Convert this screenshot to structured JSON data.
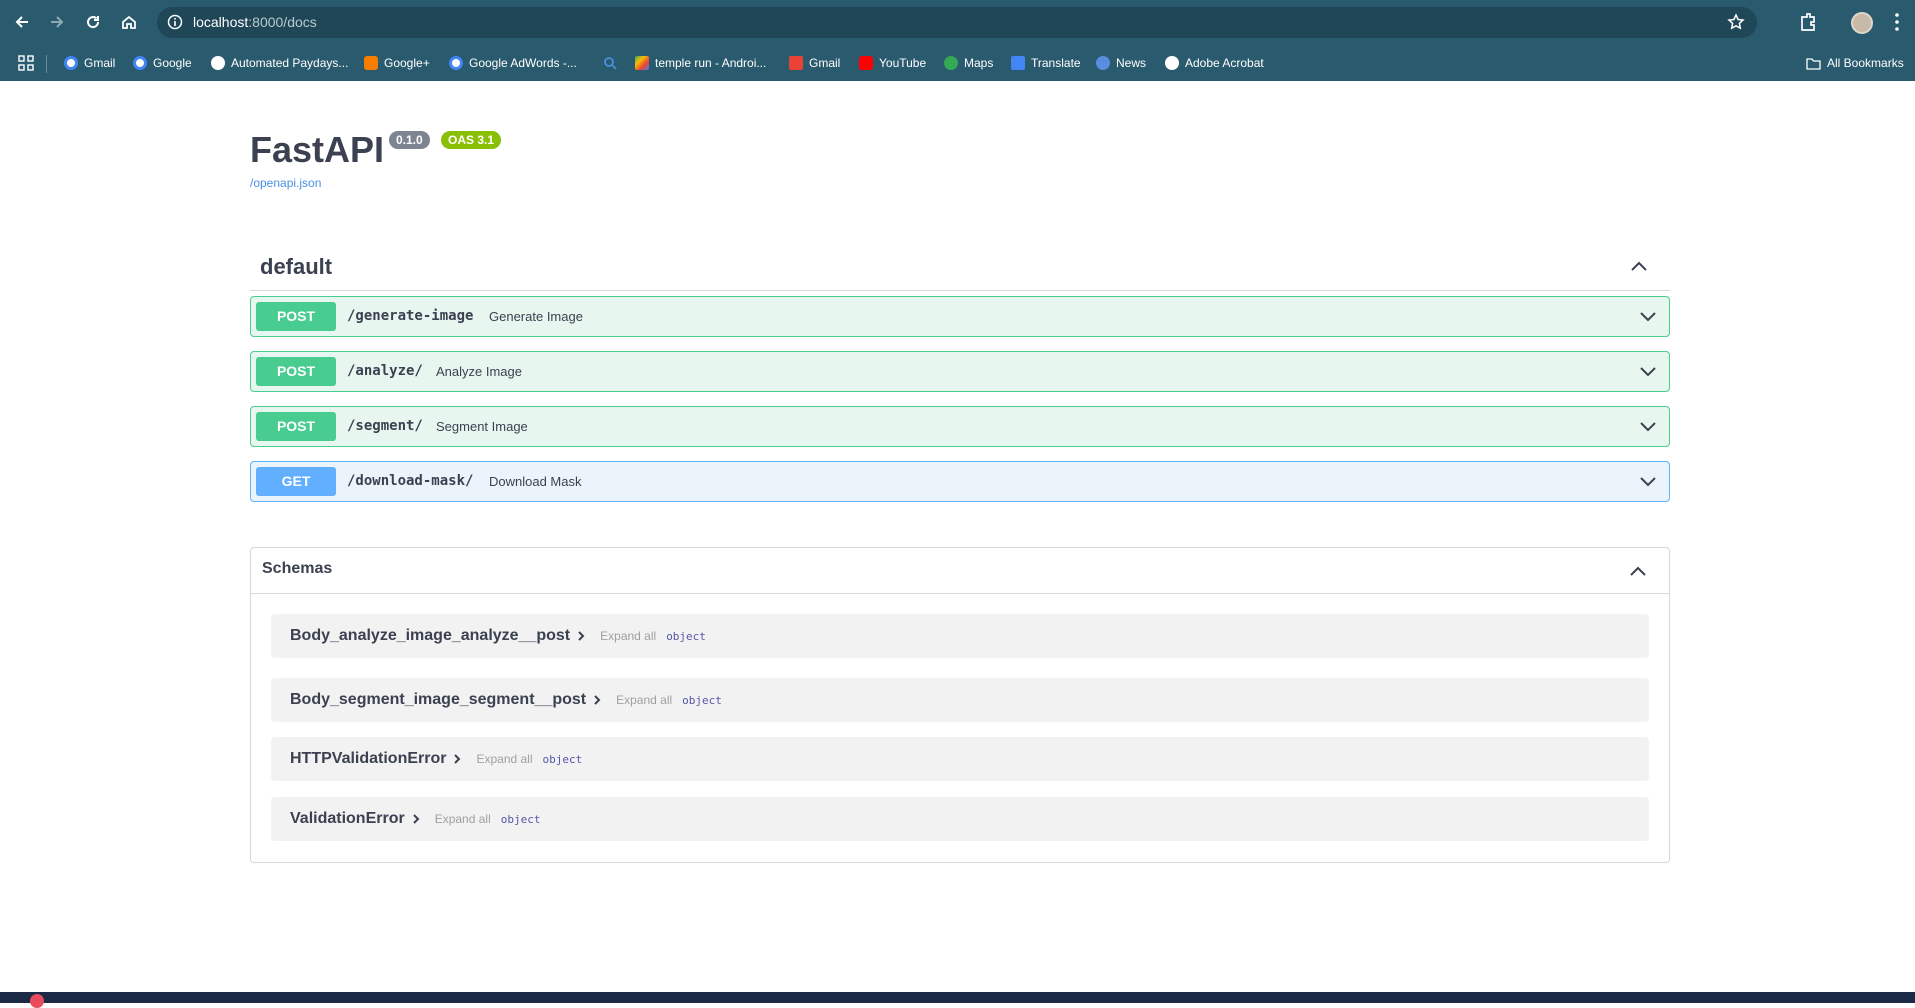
{
  "browser": {
    "url_host": "localhost",
    "url_rest": ":8000/docs",
    "bookmarks": [
      {
        "label": "Gmail",
        "icon": "google-icon"
      },
      {
        "label": "Google",
        "icon": "google-icon"
      },
      {
        "label": "Automated Paydays...",
        "icon": "globe-icon"
      },
      {
        "label": "Google+",
        "icon": "blogger-icon"
      },
      {
        "label": "Google AdWords -...",
        "icon": "google-icon"
      },
      {
        "label": "temple run - Androi...",
        "icon": "play-store-icon"
      },
      {
        "label": "Gmail",
        "icon": "gmail-icon"
      },
      {
        "label": "YouTube",
        "icon": "youtube-icon"
      },
      {
        "label": "Maps",
        "icon": "maps-icon"
      },
      {
        "label": "Translate",
        "icon": "translate-icon"
      },
      {
        "label": "News",
        "icon": "news-icon"
      },
      {
        "label": "Adobe Acrobat",
        "icon": "globe-icon"
      }
    ],
    "all_bookmarks": "All Bookmarks"
  },
  "header": {
    "title": "FastAPI",
    "version": "0.1.0",
    "oas": "OAS 3.1",
    "spec_link": "/openapi.json"
  },
  "tag": {
    "name": "default"
  },
  "operations": [
    {
      "method": "POST",
      "path": "/generate-image",
      "summary": "Generate Image"
    },
    {
      "method": "POST",
      "path": "/analyze/",
      "summary": "Analyze Image"
    },
    {
      "method": "POST",
      "path": "/segment/",
      "summary": "Segment Image"
    },
    {
      "method": "GET",
      "path": "/download-mask/",
      "summary": "Download Mask"
    }
  ],
  "schemas": {
    "title": "Schemas",
    "expand_all": "Expand all",
    "items": [
      {
        "name": "Body_analyze_image_analyze__post",
        "type": "object"
      },
      {
        "name": "Body_segment_image_segment__post",
        "type": "object"
      },
      {
        "name": "HTTPValidationError",
        "type": "object"
      },
      {
        "name": "ValidationError",
        "type": "object"
      }
    ]
  },
  "colors": {
    "chrome": "#2a5a6e",
    "post": "#49cc90",
    "get": "#61affe",
    "text": "#3b4151"
  }
}
